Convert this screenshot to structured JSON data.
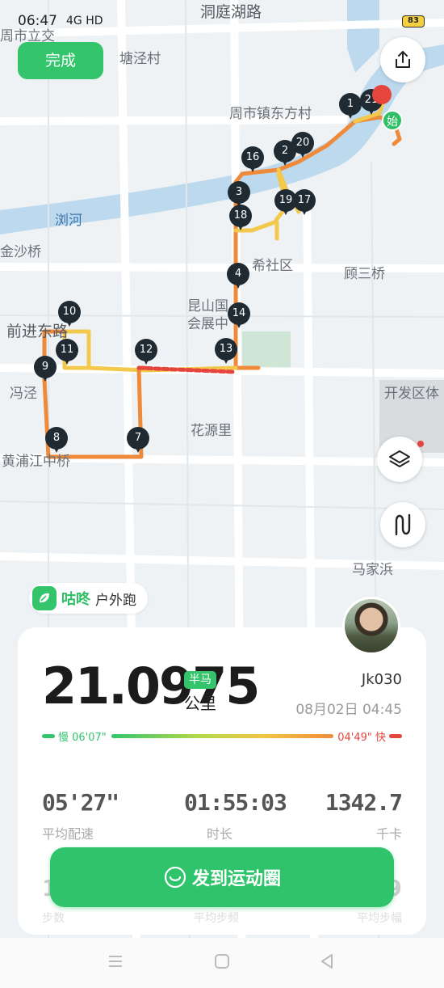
{
  "status": {
    "time": "06:47",
    "signal": "4G HD",
    "battery": "83"
  },
  "map": {
    "labels": [
      {
        "text": "洞庭湖路",
        "cls": "big"
      },
      {
        "text": "周市立交",
        "cls": ""
      },
      {
        "text": "塘泾村",
        "cls": ""
      },
      {
        "text": "周市镇东方村",
        "cls": ""
      },
      {
        "text": "浏河",
        "cls": "water"
      },
      {
        "text": "金沙桥",
        "cls": ""
      },
      {
        "text": "希社区",
        "cls": ""
      },
      {
        "text": "顾三桥",
        "cls": ""
      },
      {
        "text": "昆山国",
        "cls": ""
      },
      {
        "text": "会展中",
        "cls": ""
      },
      {
        "text": "前进东路",
        "cls": "big"
      },
      {
        "text": "冯泾",
        "cls": ""
      },
      {
        "text": "开发区体",
        "cls": ""
      },
      {
        "text": "花源里",
        "cls": ""
      },
      {
        "text": "黄浦江中桥",
        "cls": ""
      },
      {
        "text": "马家浜",
        "cls": ""
      },
      {
        "text": "桥",
        "cls": ""
      }
    ],
    "pins": [
      "1",
      "21",
      "16",
      "2",
      "20",
      "3",
      "19",
      "17",
      "18",
      "4",
      "14",
      "10",
      "11",
      "12",
      "13",
      "9",
      "8",
      "7"
    ],
    "start_label": "始"
  },
  "buttons": {
    "done": "完成"
  },
  "app": {
    "name": "咕咚",
    "type": "户外跑"
  },
  "summary": {
    "distance": "21.0975",
    "badge": "半马",
    "unit": "公里",
    "user": "Jk030",
    "date": "08月02日 04:45",
    "slow_label": "慢 06'07\"",
    "fast_label": "04'49\" 快"
  },
  "stats": [
    {
      "value": "05'27\"",
      "label": "平均配速"
    },
    {
      "value": "01:55:03",
      "label": "时长"
    },
    {
      "value": "1342.7",
      "label": "千卡"
    }
  ],
  "faded": {
    "left": "1",
    "right": "9",
    "l1": "步数",
    "l2": "平均步频",
    "l3": "平均步幅"
  },
  "share": {
    "label": "发到运动圈"
  },
  "colors": {
    "accent": "#34c46b",
    "fast": "#e6453e",
    "route_orange": "#ee8a3a",
    "route_yellow": "#f2c94c"
  }
}
